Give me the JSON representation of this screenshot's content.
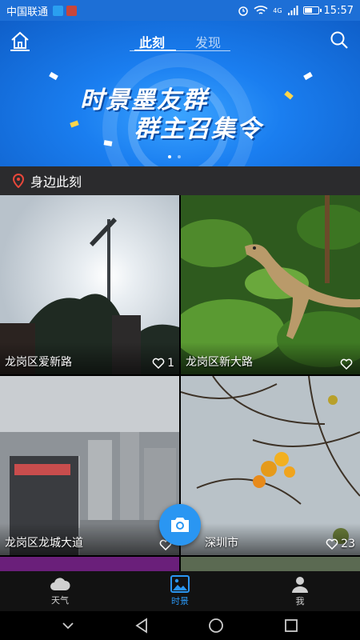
{
  "status_bar": {
    "carrier": "中国联通",
    "network": "4G",
    "time": "15:57",
    "battery_level": 0.6
  },
  "header": {
    "tabs": [
      {
        "label": "此刻",
        "active": true
      },
      {
        "label": "发现",
        "active": false
      }
    ],
    "home_icon": "home-icon",
    "search_icon": "search-icon"
  },
  "banner": {
    "line1": "时景墨友群",
    "line2": "群主召集令",
    "page_count": 2,
    "current_page": 1
  },
  "section": {
    "icon": "location-pin-icon",
    "title": "身边此刻",
    "accent_color": "#e8473a"
  },
  "photos": [
    {
      "location": "龙岗区爱新路",
      "likes": "1",
      "scene": "street-lamp-sky"
    },
    {
      "location": "龙岗区新大路",
      "likes": "",
      "scene": "lizard-leaves"
    },
    {
      "location": "龙岗区龙城大道",
      "likes": "",
      "scene": "city-skyline"
    },
    {
      "location": "深圳市",
      "likes": "23",
      "scene": "yellow-flowers-branches"
    }
  ],
  "bottom_tabs": [
    {
      "label": "天气",
      "icon": "cloud-icon",
      "active": false
    },
    {
      "label": "时景",
      "icon": "photo-icon",
      "active": true
    },
    {
      "label": "我",
      "icon": "person-icon",
      "active": false
    }
  ],
  "colors": {
    "primary": "#1d6fd6",
    "accent": "#2a96f2"
  }
}
